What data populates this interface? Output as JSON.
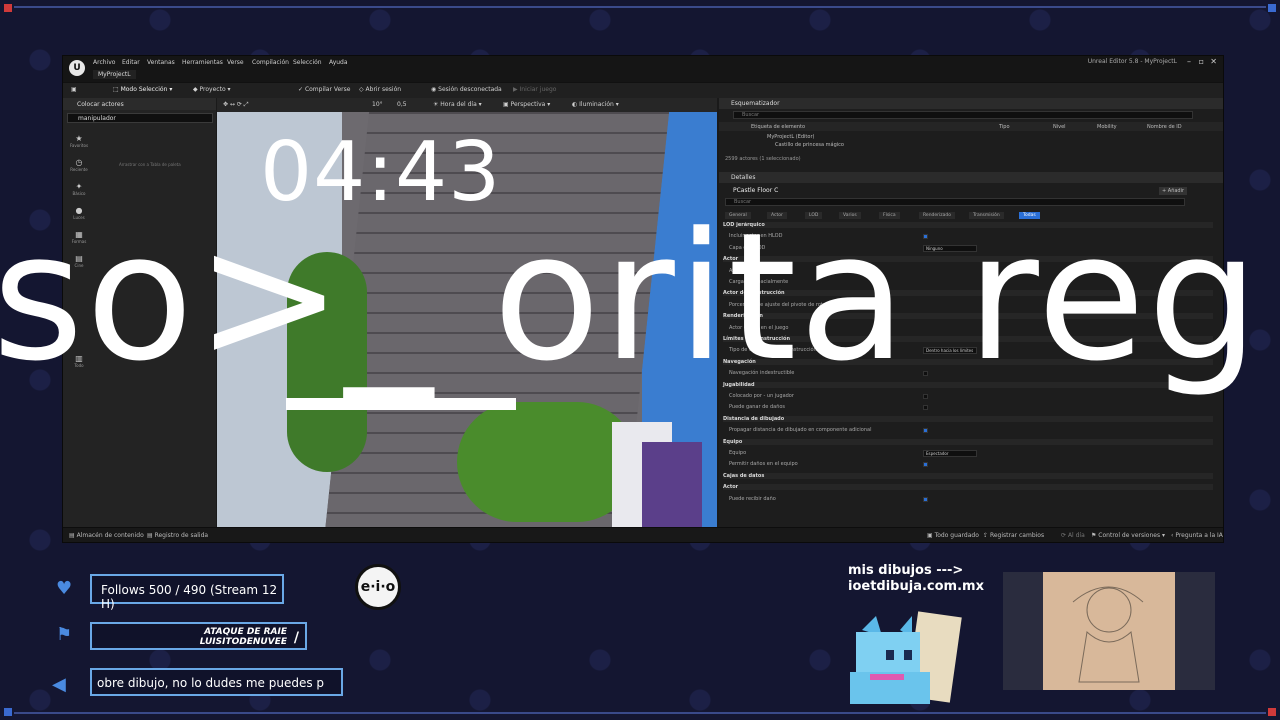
{
  "editor": {
    "menus": [
      "Archivo",
      "Editar",
      "Ventanas",
      "Herramientas",
      "Verse",
      "Compilación",
      "Selección",
      "Ayuda"
    ],
    "project_tab": "MyProjectL",
    "window_title": "Unreal Editor 5.8 - MyProjectL",
    "toolbar": {
      "mode": "Modo Selección",
      "project": "Proyecto",
      "compile": "Compilar Verse",
      "open_session": "Abrir sesión",
      "session_status": "Sesión desconectada",
      "start_game": "Iniciar juego"
    },
    "viewport_toolbar": {
      "time_of_day": "Hora del día",
      "perspective": "Perspectiva",
      "lighting": "Iluminación",
      "grid_value": "10°",
      "scale_value": "0,5"
    },
    "left_panel": {
      "title": "Colocar actores",
      "search_value": "manipulador",
      "hint": "Arrastrar con a Tabla de paleta",
      "categories": [
        "Favoritos",
        "Reciente",
        "Básico",
        "Luces",
        "Formas",
        "Cine",
        "Todo"
      ]
    },
    "outliner": {
      "title": "Esquematizador",
      "search_placeholder": "Buscar",
      "columns": [
        "Etiqueta de elemento",
        "Tipo",
        "Nivel",
        "Mobility",
        "Nombre de ID"
      ],
      "rows": [
        "MyProjectL (Editor)",
        "Castillo de princesa mágico"
      ],
      "footer": "2599 actores (1 seleccionado)"
    },
    "details": {
      "title": "Detalles",
      "object_name": "PCastle Floor C",
      "add_label": "Añadir",
      "search_placeholder": "Buscar",
      "tabs": [
        "General",
        "Actor",
        "LOD",
        "Varios",
        "Física",
        "Renderizado",
        "Transmisión",
        "Todas"
      ],
      "rows": [
        {
          "type": "section",
          "label": "LOD jerárquico"
        },
        {
          "type": "row",
          "label": "Incluir actor en HLOD",
          "check": true
        },
        {
          "type": "row",
          "label": "Capa de HLOD",
          "drop": "Ninguno"
        },
        {
          "type": "section",
          "label": "Actor"
        },
        {
          "type": "row",
          "label": "Avanzado"
        },
        {
          "type": "row",
          "label": "Cargado espacialmente"
        },
        {
          "type": "section",
          "label": "Actor de construcción"
        },
        {
          "type": "row",
          "label": "Porcentaje de ajuste del pivote de rotación"
        },
        {
          "type": "section",
          "label": "Renderización"
        },
        {
          "type": "row",
          "label": "Actor oculto en el juego"
        },
        {
          "type": "section",
          "label": "Límites de construcción"
        },
        {
          "type": "row",
          "label": "Tipo de colocación de construcción deseado",
          "drop": "Dentro hacia los límites"
        },
        {
          "type": "section",
          "label": "Navegación"
        },
        {
          "type": "row",
          "label": "Navegación indestructible",
          "check": false
        },
        {
          "type": "section",
          "label": "Jugabilidad"
        },
        {
          "type": "row",
          "label": "Colocado por - un jugador",
          "check": false
        },
        {
          "type": "row",
          "label": "Puede ganar de daños",
          "check": false
        },
        {
          "type": "section",
          "label": "Distancia de dibujado"
        },
        {
          "type": "row",
          "label": "Propagar distancia de dibujado en componente adicional",
          "check": true
        },
        {
          "type": "section",
          "label": "Equipo"
        },
        {
          "type": "row",
          "label": "Equipo",
          "drop": "Espectador"
        },
        {
          "type": "row",
          "label": "Permitir daños en el equipo",
          "check": true
        },
        {
          "type": "section",
          "label": "Cajas de datos"
        },
        {
          "type": "section",
          "label": "Actor"
        },
        {
          "type": "row",
          "label": "Puede recibir daño",
          "check": true
        }
      ]
    },
    "statusbar": {
      "content_drawer": "Almacén de contenido",
      "output_log": "Registro de salida",
      "saved": "Todo guardado",
      "register_changes": "Registrar cambios",
      "sync": "Al día",
      "source_control": "Control de versiones",
      "ask_ai": "Pregunta a la IA"
    }
  },
  "overlay": {
    "timer": "04:43",
    "marquee": "so>_ orita reg",
    "follows": "Follows 500 / 490 (Stream 12 H)",
    "raid_line1": "ATAQUE DE RAIE",
    "raid_line2": "LUISITODENUVEE",
    "ticker": "obre dibujo, no lo dudes me puedes p",
    "promo_line1": "mis dibujos --->",
    "promo_line2": "ioetdibuja.com.mx",
    "logo_text": "e·i·o"
  },
  "colors": {
    "background": "#141631",
    "widget_border": "#6aa8e6",
    "accent_blue": "#2a6fd6",
    "frame_red": "#d03a3a"
  }
}
